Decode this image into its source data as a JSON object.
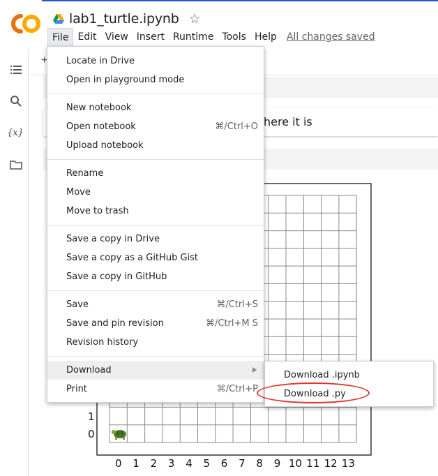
{
  "header": {
    "notebook_title": "lab1_turtle.ipynb",
    "saved_status": "All changes saved"
  },
  "menubar": {
    "items": [
      "File",
      "Edit",
      "View",
      "Insert",
      "Runtime",
      "Tools",
      "Help"
    ]
  },
  "cell": {
    "text_fragment": "here it is",
    "add_glyph": "+"
  },
  "file_menu": {
    "items": [
      {
        "label": "Locate in Drive",
        "shortcut": ""
      },
      {
        "label": "Open in playground mode",
        "shortcut": ""
      },
      {
        "label": "New notebook",
        "shortcut": ""
      },
      {
        "label": "Open notebook",
        "shortcut": "⌘/Ctrl+O"
      },
      {
        "label": "Upload notebook",
        "shortcut": ""
      },
      {
        "label": "Rename",
        "shortcut": ""
      },
      {
        "label": "Move",
        "shortcut": ""
      },
      {
        "label": "Move to trash",
        "shortcut": ""
      },
      {
        "label": "Save a copy in Drive",
        "shortcut": ""
      },
      {
        "label": "Save a copy as a GitHub Gist",
        "shortcut": ""
      },
      {
        "label": "Save a copy in GitHub",
        "shortcut": ""
      },
      {
        "label": "Save",
        "shortcut": "⌘/Ctrl+S"
      },
      {
        "label": "Save and pin revision",
        "shortcut": "⌘/Ctrl+M S"
      },
      {
        "label": "Revision history",
        "shortcut": ""
      },
      {
        "label": "Download",
        "shortcut": ""
      },
      {
        "label": "Print",
        "shortcut": "⌘/Ctrl+P"
      }
    ]
  },
  "download_submenu": {
    "items": [
      "Download .ipynb",
      "Download .py"
    ]
  },
  "grid": {
    "x_ticks": [
      "0",
      "1",
      "2",
      "3",
      "4",
      "5",
      "6",
      "7",
      "8",
      "9",
      "10",
      "11",
      "12",
      "13"
    ],
    "y_ticks": [
      "1",
      "0"
    ]
  },
  "colors": {
    "accent": "#2a56c6",
    "annotation": "#e0352b",
    "logo_orange": "#f9ab00",
    "logo_dark": "#e8710a"
  },
  "icons": [
    "drive-icon",
    "star-icon",
    "toc-icon",
    "search-icon",
    "variables-icon",
    "folder-icon",
    "turtle-icon",
    "submenu-arrow-icon"
  ]
}
